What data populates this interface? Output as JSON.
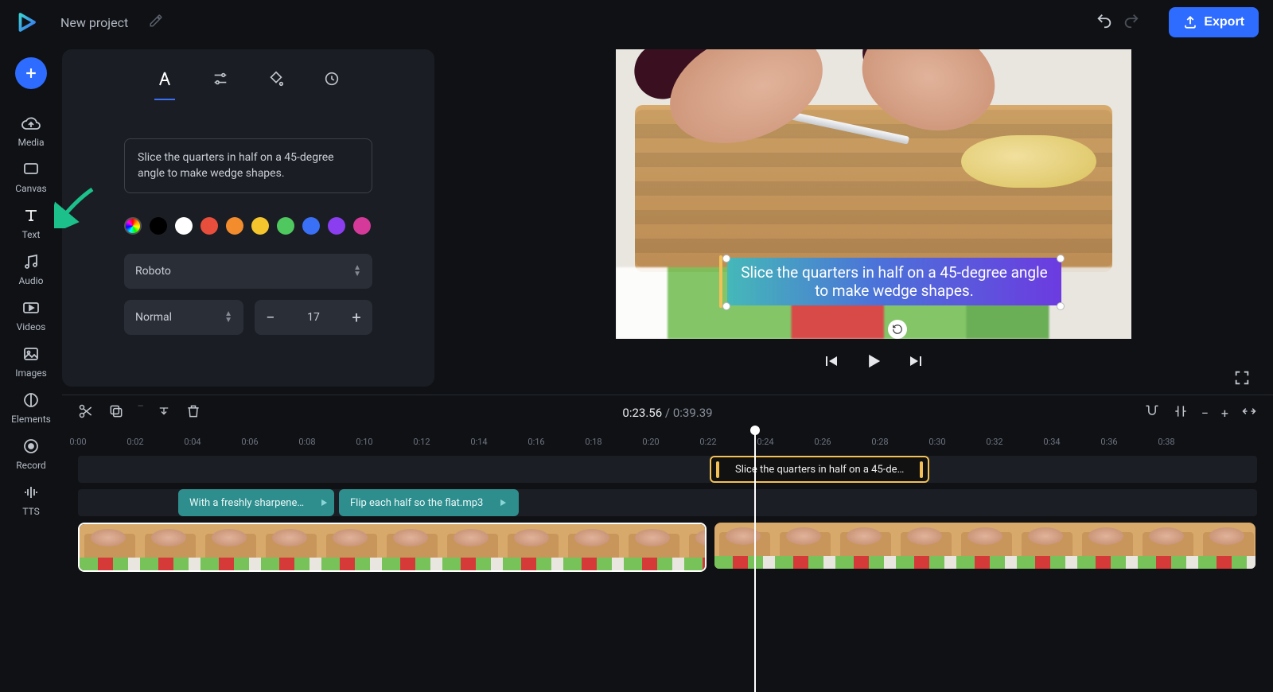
{
  "header": {
    "project_name": "New project",
    "export_label": "Export"
  },
  "rail": {
    "items": [
      {
        "label": "Media",
        "icon": "media"
      },
      {
        "label": "Canvas",
        "icon": "canvas"
      },
      {
        "label": "Text",
        "icon": "text"
      },
      {
        "label": "Audio",
        "icon": "audio"
      },
      {
        "label": "Videos",
        "icon": "videos"
      },
      {
        "label": "Images",
        "icon": "images"
      },
      {
        "label": "Elements",
        "icon": "elements"
      },
      {
        "label": "Record",
        "icon": "record"
      },
      {
        "label": "TTS",
        "icon": "tts"
      }
    ]
  },
  "text_props": {
    "value": "Slice the quarters in half on a 45-degree angle to make wedge shapes.",
    "colors": [
      "rainbow",
      "#000000",
      "#ffffff",
      "#e84e3c",
      "#f28c2d",
      "#f4c52d",
      "#4ec85f",
      "#3a70f5",
      "#8a3ef0",
      "#d53a9b"
    ],
    "font_family": "Roboto",
    "font_weight": "Normal",
    "font_size": "17"
  },
  "preview": {
    "overlay_text": "Slice the quarters in half on a 45-degree angle to make wedge shapes."
  },
  "timeline": {
    "current": "0:23.56",
    "duration": "0:39.39",
    "ticks": [
      "0:00",
      "0:02",
      "0:04",
      "0:06",
      "0:08",
      "0:10",
      "0:12",
      "0:14",
      "0:16",
      "0:18",
      "0:20",
      "0:22",
      "0:24",
      "0:26",
      "0:28",
      "0:30",
      "0:32",
      "0:34",
      "0:36",
      "0:38"
    ],
    "text_clip": {
      "label": "Slice the quarters in half on a 45-de…"
    },
    "audio_clips": [
      {
        "label": "With a freshly sharpene…"
      },
      {
        "label": "Flip each half so the flat.mp3"
      }
    ]
  }
}
